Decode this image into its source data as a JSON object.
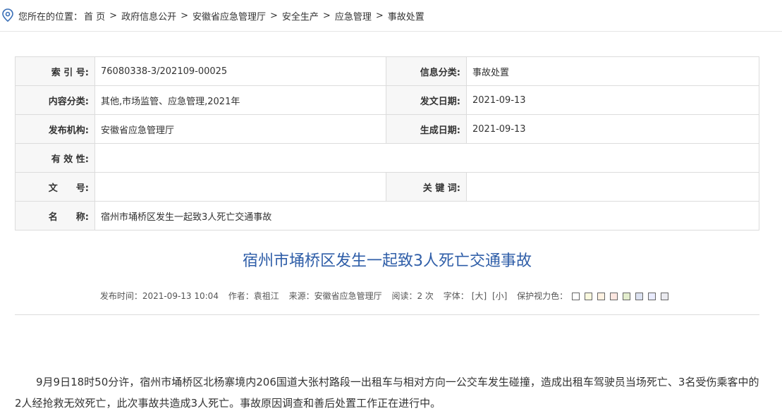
{
  "breadcrumb": {
    "prefix": "您所在的位置：",
    "items": [
      "首 页",
      "政府信息公开",
      "安徽省应急管理厅",
      "安全生产",
      "应急管理"
    ],
    "current": "事故处置",
    "separator": ">"
  },
  "meta": {
    "index_label": "索 引 号:",
    "index_value": "76080338-3/202109-00025",
    "info_category_label": "信息分类:",
    "info_category_value": "事故处置",
    "content_category_label": "内容分类:",
    "content_category_value": "其他,市场监管、应急管理,2021年",
    "issue_date_label": "发文日期:",
    "issue_date_value": "2021-09-13",
    "publisher_label": "发布机构:",
    "publisher_value": "安徽省应急管理厅",
    "created_date_label": "生成日期:",
    "created_date_value": "2021-09-13",
    "validity_label": "有 效 性:",
    "validity_value": "",
    "doc_number_label": "文　　号:",
    "doc_number_value": "",
    "keywords_label": "关 键 词:",
    "keywords_value": "",
    "name_label": "名　　称:",
    "name_value": "宿州市埇桥区发生一起致3人死亡交通事故"
  },
  "article": {
    "title": "宿州市埇桥区发生一起致3人死亡交通事故",
    "publish_time": "发布时间：2021-09-13 10:04",
    "author": "作者：袁祖江",
    "source": "来源：安徽省应急管理厅",
    "reads": "阅读：2 次",
    "font_label": "字体：",
    "font_large": "[大]",
    "font_small": "[小]",
    "eye_care_label": "保护视力色：",
    "eye_care_colors": [
      "#ffffff",
      "#faf9de",
      "#fff2e2",
      "#fde6e0",
      "#e3edcd",
      "#dce2f1",
      "#e9ebfe",
      "#eaeaef"
    ],
    "body": "9月9日18时50分许，宿州市埇桥区北杨寨境内206国道大张村路段一出租车与相对方向一公交车发生碰撞，造成出租车驾驶员当场死亡、3名受伤乘客中的2人经抢救无效死亡，此次事故共造成3人死亡。事故原因调查和善后处置工作正在进行中。"
  },
  "colors": {
    "title": "#2f5ea8",
    "location_icon": "#3a6fb7"
  }
}
